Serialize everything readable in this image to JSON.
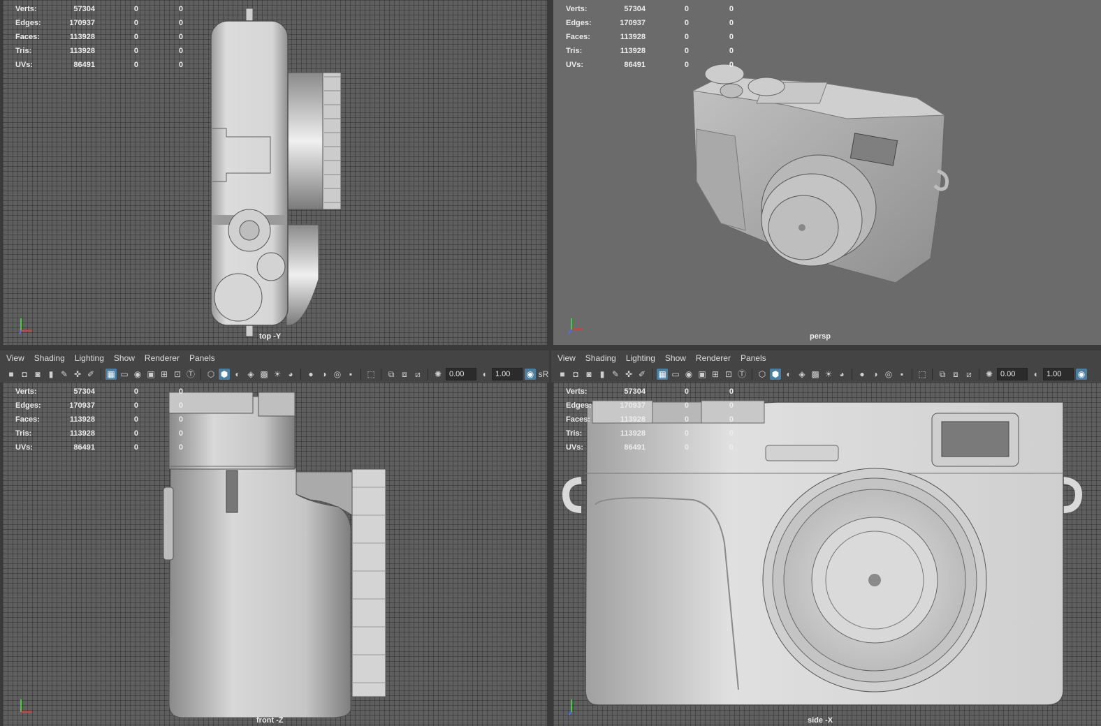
{
  "stats_labels": [
    "Verts:",
    "Edges:",
    "Faces:",
    "Tris:",
    "UVs:"
  ],
  "stats": {
    "verts": [
      "57304",
      "0",
      "0"
    ],
    "edges": [
      "170937",
      "0",
      "0"
    ],
    "faces": [
      "113928",
      "0",
      "0"
    ],
    "tris": [
      "113928",
      "0",
      "0"
    ],
    "uvs": [
      "86491",
      "0",
      "0"
    ]
  },
  "viewports": {
    "top": {
      "camera": "top -Y"
    },
    "persp": {
      "camera": "persp"
    },
    "front": {
      "camera": "front -Z"
    },
    "side": {
      "camera": "side -X"
    }
  },
  "menus": [
    "View",
    "Shading",
    "Lighting",
    "Show",
    "Renderer",
    "Panels"
  ],
  "toolbar": {
    "exposure": "0.00",
    "gamma": "1.00",
    "colorspace_label": "sR"
  },
  "icons": [
    "camera-icon",
    "camera-attributes-icon",
    "bookmark-icon",
    "image-plane-icon",
    "grid-icon",
    "wireframe-icon",
    "smooth-shade-icon",
    "lighting-icon",
    "shadows-icon",
    "isolate-icon",
    "xray-icon",
    "exposure-icon",
    "gamma-icon"
  ],
  "axis": {
    "x": "x",
    "y": "y",
    "z": "z"
  },
  "colors": {
    "accent": "#4a7fa1",
    "axis_x": "#e03a3a",
    "axis_y": "#3fcf3f",
    "axis_z": "#4a6cff"
  }
}
